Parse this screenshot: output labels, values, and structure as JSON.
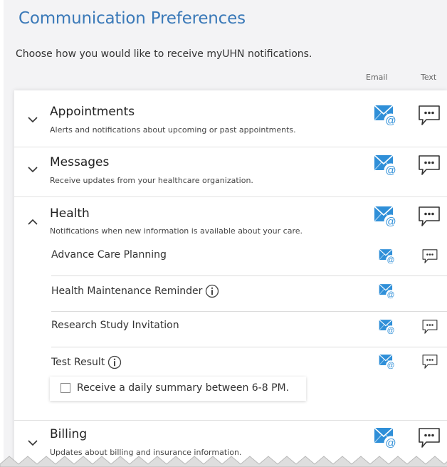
{
  "page": {
    "title": "Communication Preferences",
    "subtitle": "Choose how you would like to receive myUHN notifications.",
    "columns": {
      "email": "Email",
      "text": "Text"
    }
  },
  "sections": [
    {
      "title": "Appointments",
      "description": "Alerts and notifications about upcoming or past appointments.",
      "expanded": false,
      "icons": [
        "email-icon",
        "text-message-icon"
      ]
    },
    {
      "title": "Messages",
      "description": "Receive updates from your healthcare organization.",
      "expanded": false,
      "icons": [
        "email-icon",
        "text-message-icon"
      ]
    },
    {
      "title": "Health",
      "description": "Notifications when new information is available about your care.",
      "expanded": true,
      "icons": [
        "email-icon",
        "text-message-icon"
      ]
    },
    {
      "title": "Billing",
      "description": "Updates about billing and insurance information.",
      "expanded": false,
      "icons": [
        "email-icon",
        "text-message-icon"
      ]
    }
  ],
  "health_items": [
    {
      "label": "Advance Care Planning",
      "info": false,
      "email": true,
      "text": true
    },
    {
      "label": "Health Maintenance Reminder",
      "info": true,
      "email": true,
      "text": false
    },
    {
      "label": "Research Study Invitation",
      "info": false,
      "email": true,
      "text": true
    },
    {
      "label": "Test Result",
      "info": true,
      "email": true,
      "text": true
    }
  ],
  "test_result_option": {
    "label": "Receive a daily summary between 6-8 PM.",
    "checked": false
  },
  "colors": {
    "title": "#3a79b8",
    "email_icon": "#2f8fd8",
    "background": "#f3f3f5"
  }
}
